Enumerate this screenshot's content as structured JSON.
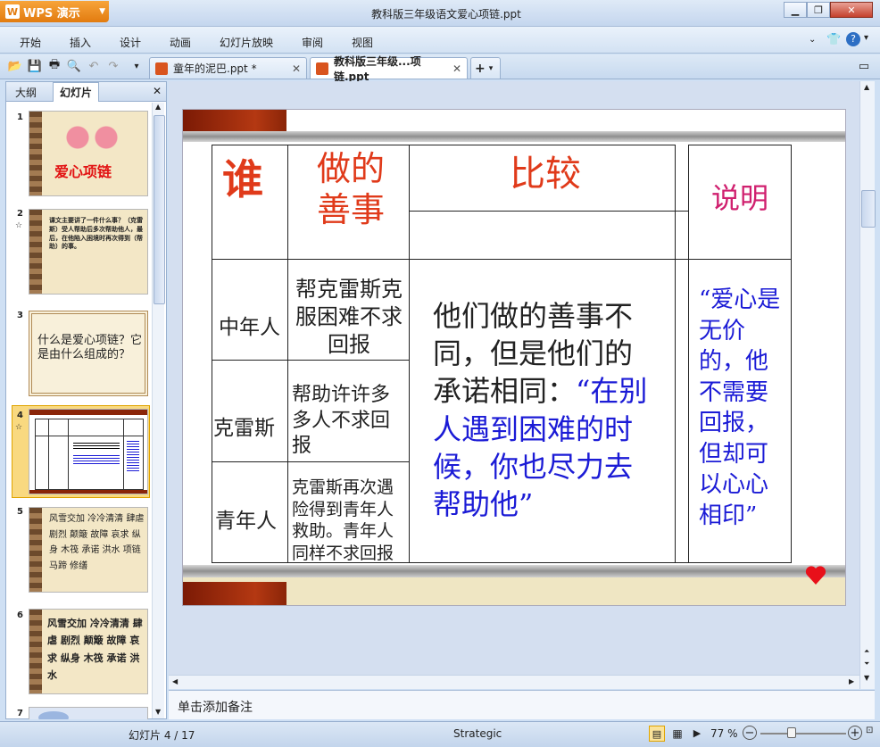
{
  "app": {
    "brand": "WPS 演示",
    "window_title": "教科版三年级语文爱心项链.ppt"
  },
  "menu": [
    "开始",
    "插入",
    "设计",
    "动画",
    "幻灯片放映",
    "审阅",
    "视图"
  ],
  "tabs": [
    {
      "label": "童年的泥巴.ppt *",
      "active": false
    },
    {
      "label": "教科版三年级...项链.ppt",
      "active": true
    }
  ],
  "left_pane": {
    "tabs": [
      "大纲",
      "幻灯片"
    ],
    "thumbnails": [
      {
        "num": "1",
        "title": "爱心项链"
      },
      {
        "num": "2",
        "text": "课文主要讲了一件什么事？（克雷斯）受人帮助后多次帮助他人，最后，在他陷入困境时再次得到（帮助）的事。"
      },
      {
        "num": "3",
        "text": "什么是爱心项链？它是由什么组成的？"
      },
      {
        "num": "4",
        "text": ""
      },
      {
        "num": "5",
        "text": "风雪交加 冷冷清清 肆虐 剧烈 颠簸 故障 哀求 纵身 木筏 承诺 洪水 项链 马蹄 修缮"
      },
      {
        "num": "6",
        "text": "风雪交加 冷冷清清 肆虐 剧烈 颠簸 故障 哀求 纵身 木筏 承诺 洪水"
      },
      {
        "num": "7",
        "text": ""
      }
    ]
  },
  "slide": {
    "header_who": "谁",
    "header_deed": "做的善事",
    "header_compare": "比较",
    "header_explain": "说明",
    "rows": [
      {
        "who": "中年人",
        "deed": "帮克雷斯克服困难不求回报"
      },
      {
        "who": "克雷斯",
        "deed": "帮助许许多多人不求回报"
      },
      {
        "who": "青年人",
        "deed": "克雷斯再次遇险得到青年人救助。青年人同样不求回报"
      }
    ],
    "compare_text_black": "他们做的善事不同，但是他们的承诺相同：",
    "compare_text_blue": "“在别人遇到困难的时候，你也尽力去帮助他”",
    "explain_text": "“爱心是无价的，他不需要回报，但却可以心心相印”"
  },
  "notes_placeholder": "单击添加备注",
  "status": {
    "slide_counter": "幻灯片 4 / 17",
    "theme": "Strategic",
    "zoom": "77 %"
  },
  "colors": {
    "accent_orange": "#e6801a",
    "slide_red": "#d8331f",
    "slide_blue": "#1b1bd6",
    "slide_magenta": "#d0206f"
  }
}
